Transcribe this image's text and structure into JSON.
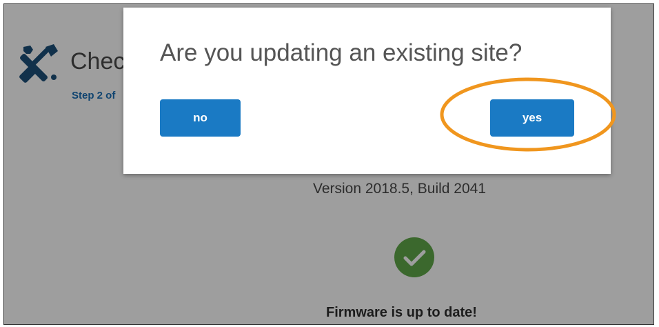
{
  "page": {
    "title": "Chec",
    "step": "Step 2 of",
    "version": "Version 2018.5, Build 2041",
    "firmware_status": "Firmware is up to date!",
    "icons": {
      "tools": "wrench-screwdriver-icon",
      "status": "checkmark-icon"
    }
  },
  "dialog": {
    "question": "Are you updating an existing site?",
    "no_label": "no",
    "yes_label": "yes"
  },
  "colors": {
    "button": "#1a7ac4",
    "highlight": "#f0961e",
    "success": "#5fa84a",
    "step_text": "#1a6fb5",
    "icon": "#1c4f7a"
  }
}
